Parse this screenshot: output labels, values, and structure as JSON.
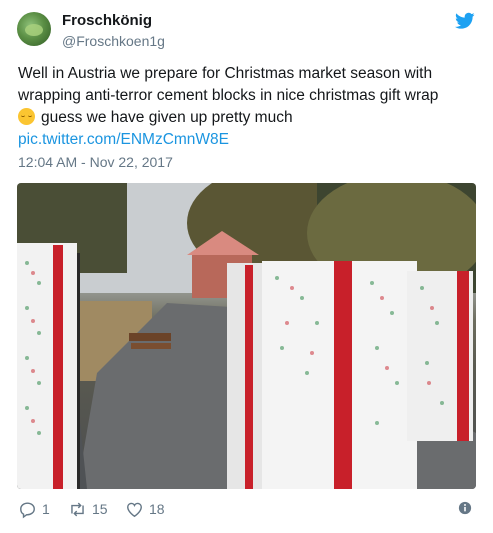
{
  "author": {
    "display_name": "Froschkönig",
    "handle": "@Froschkoen1g"
  },
  "tweet": {
    "line1": "Well in Austria we prepare for Christmas market season with",
    "line2": "wrapping anti-terror cement blocks in nice christmas gift wrap",
    "line3": "guess we have given up pretty much",
    "emoji": "relieved-face-emoji",
    "link": "pic.twitter.com/ENMzCmnW8E",
    "timestamp": "12:04 AM - Nov 22, 2017"
  },
  "photo": {
    "subject": "photo"
  },
  "actions": {
    "replies": "1",
    "retweets": "15",
    "likes": "18"
  },
  "colors": {
    "text": "#14171a",
    "secondary": "#657786",
    "link": "#1b95e0",
    "twitter_blue": "#1da1f2",
    "wrap_red": "#c8202a"
  }
}
